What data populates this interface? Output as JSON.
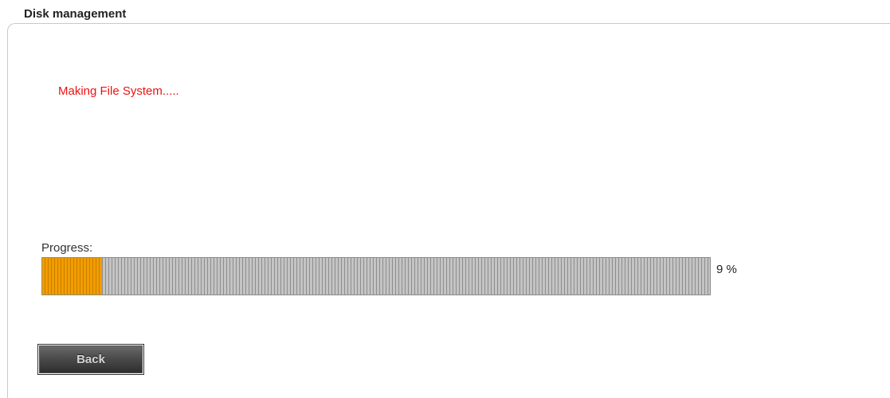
{
  "panel": {
    "title": "Disk management"
  },
  "status": {
    "message": "Making File System.....",
    "color": "#ee1111"
  },
  "progress": {
    "label": "Progress:",
    "value_percent": 9,
    "percent_text": "9 %",
    "fill_color": "#f29d00",
    "track_color": "#c4c4c4"
  },
  "actions": {
    "back_label": "Back"
  }
}
